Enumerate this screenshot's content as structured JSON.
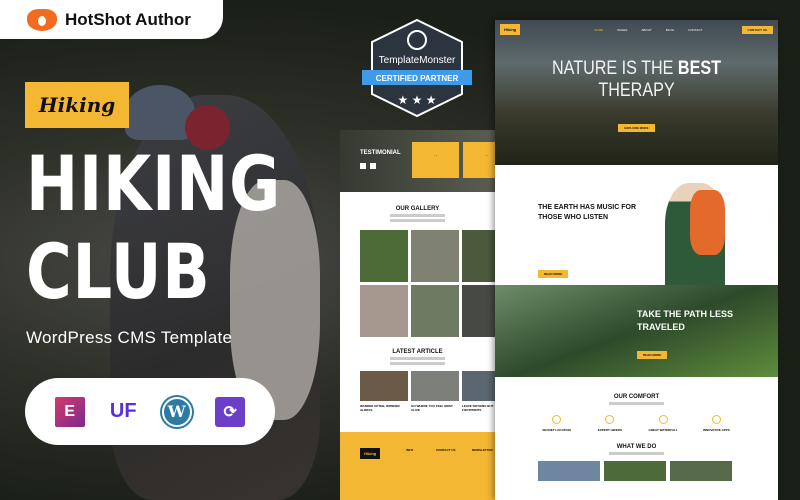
{
  "brand": {
    "name": "HotShot Author",
    "icon": "fox-icon"
  },
  "hero": {
    "tag": "Hiking",
    "title_line1": "HIKING",
    "title_line2": "CLUB",
    "subtitle": "WordPress CMS Template"
  },
  "tech_icons": [
    "elementor-icon",
    "uf-icon",
    "wordpress-icon",
    "update-icon"
  ],
  "badge": {
    "name": "TemplateMonster",
    "label": "CERTIFIED PARTNER",
    "stars": 3
  },
  "colors": {
    "accent": "#f3b734",
    "badge_blue": "#3d9be9",
    "badge_dark": "#2c3440"
  },
  "preview": {
    "logo": "Hiking",
    "nav": [
      "HOME",
      "PAGES",
      "ABOUT",
      "BLOG",
      "CONTACT"
    ],
    "contact_button": "CONTACT US",
    "hero_outline": "NATURE IS THE",
    "hero_bold": "BEST",
    "hero_line2": "THERAPY",
    "explore_button": "EXPLORE MORE",
    "earth_title_1": "THE EARTH HAS MUSIC FOR",
    "earth_title_2": "THOSE WHO LISTEN",
    "read_more": "READ MORE",
    "path_title_1": "TAKE THE PATH LESS",
    "path_title_2": "TRAVELED",
    "comfort_title": "OUR COMFORT",
    "features": [
      "SECRET LOCATION",
      "EXPERT HIKERS",
      "GREAT WATERFALL",
      "INNOVATIVE APPS"
    ],
    "what_we_do": "WHAT WE DO",
    "testimonial": "TESTIMONIAL",
    "gallery_title": "OUR GALLERY",
    "article_title": "LATEST ARTICLE",
    "articles": [
      "WANDER OFTEN, WONDER ALWAYS",
      "GO WHERE YOU FEEL MOST ALIVE",
      "LEAVE NOTHING BUT FOOTPRINTS"
    ],
    "footer_cols": [
      "INFO",
      "CONTACT US",
      "NEWSLETTER"
    ]
  }
}
